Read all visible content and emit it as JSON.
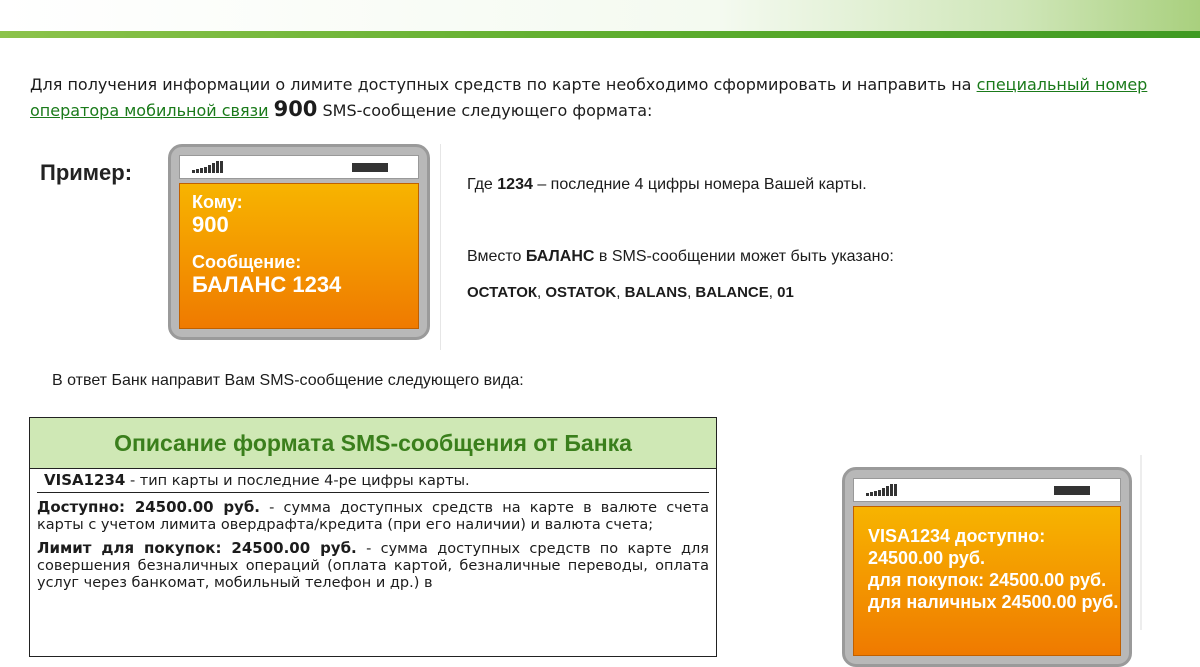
{
  "intro": {
    "text_before": "Для получения информации о лимите доступных средств по карте необходимо сформировать и направить на ",
    "link": "специальный номер оператора мобильной связи",
    "number": "900",
    "text_after": " SMS-сообщение следующего формата:"
  },
  "example": {
    "label": "Пример:",
    "to_label": "Кому:",
    "to_value": "900",
    "msg_label": "Сообщение:",
    "msg_value": "БАЛАНС 1234"
  },
  "where": {
    "prefix": "Где ",
    "code": "1234",
    "suffix": " – последние 4 цифры номера Вашей карты."
  },
  "instead": {
    "prefix": "Вместо ",
    "word": "БАЛАНС",
    "suffix": " в SMS-сообщении может быть указано:",
    "alternatives": [
      {
        "word": "ОСТАТОК",
        "sep": ", "
      },
      {
        "word": "OSTATOK",
        "sep": ", "
      },
      {
        "word": "BALANS",
        "sep": ", "
      },
      {
        "word": "BALANCE",
        "sep": ", "
      },
      {
        "word": "01",
        "sep": ""
      }
    ]
  },
  "reply": "В ответ Банк направит Вам SMS-сообщение следующего вида:",
  "format": {
    "title": "Описание формата SMS-сообщения от Банка",
    "rows": [
      {
        "key": "VISA1234",
        "desc": " - тип карты и последние 4-ре цифры карты."
      },
      {
        "key": "Доступно: 24500.00 руб.",
        "desc": " - сумма доступных средств на карте в валюте счета карты с учетом лимита овердрафта/кредита (при его наличии) и валюта счета;"
      },
      {
        "key": "Лимит для покупок: 24500.00 руб.",
        "desc": " - сумма доступных средств по карте для совершения безналичных операций (оплата картой, безналичные переводы, оплата услуг через банкомат, мобильный телефон и др.) в"
      }
    ]
  },
  "sms_reply": {
    "lines": [
      "VISA1234 доступно:",
      "24500.00 руб.",
      "для покупок: 24500.00 руб.",
      "для наличных 24500.00 руб."
    ]
  },
  "colors": {
    "accent_green": "#3a7f1c",
    "screen_orange": "#f49a00",
    "header_bg": "#cfe8b5"
  }
}
